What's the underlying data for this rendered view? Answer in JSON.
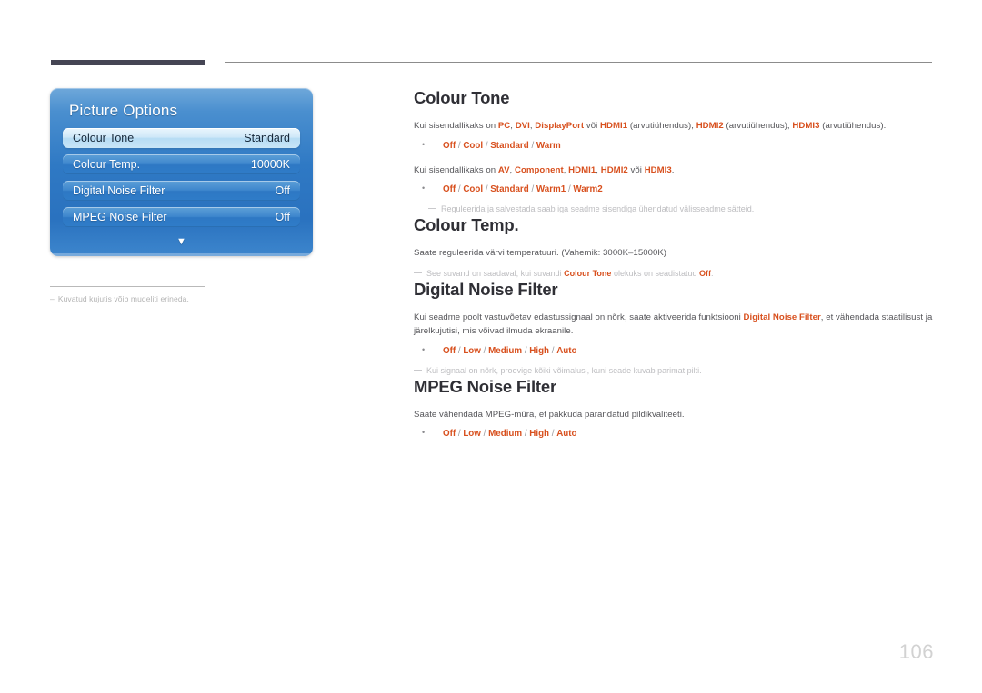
{
  "page": {
    "number": "106",
    "language": "Estonian"
  },
  "osd": {
    "title": "Picture Options",
    "scroll_indicator": "▼",
    "rows": [
      {
        "label": "Colour Tone",
        "value": "Standard",
        "selected": true
      },
      {
        "label": "Colour Temp.",
        "value": "10000K",
        "selected": false
      },
      {
        "label": "Digital Noise Filter",
        "value": "Off",
        "selected": false
      },
      {
        "label": "MPEG Noise Filter",
        "value": "Off",
        "selected": false
      }
    ],
    "caption": "Kuvatud kujutis võib mudeliti erineda.",
    "caption_dash": "–"
  },
  "sections": {
    "colour_tone": {
      "title": "Colour Tone",
      "para1": {
        "pre": "Kui sisendallikaks on ",
        "src1": "PC",
        "s1": ", ",
        "src2": "DVI",
        "s2": ", ",
        "src3": "DisplayPort",
        "s3": " või ",
        "src4": "HDMI1",
        "s4": " (arvutiühendus), ",
        "src5": "HDMI2",
        "s5": " (arvutiühendus), ",
        "src6": "HDMI3",
        "s6": " (arvutiühendus)."
      },
      "options1": [
        "Off",
        "Cool",
        "Standard",
        "Warm"
      ],
      "para2": {
        "pre": "Kui sisendallikaks on ",
        "src1": "AV",
        "s1": ", ",
        "src2": "Component",
        "s2": ", ",
        "src3": "HDMI1",
        "s3": ", ",
        "src4": "HDMI2",
        "s4": "  või ",
        "src5": "HDMI3",
        "s5": "."
      },
      "options2": [
        "Off",
        "Cool",
        "Standard",
        "Warm1",
        "Warm2"
      ],
      "note": "Reguleerida ja salvestada saab iga seadme sisendiga ühendatud välisseadme sätteid."
    },
    "colour_temp": {
      "title": "Colour Temp.",
      "para1": "Saate reguleerida värvi temperatuuri. (Vahemik: 3000K–15000K)",
      "note": {
        "pre": "See suvand on saadaval, kui suvandi ",
        "hl1": "Colour Tone",
        "mid": " olekuks on seadistatud ",
        "hl2": "Off",
        "post": "."
      }
    },
    "digital_noise_filter": {
      "title": "Digital Noise Filter",
      "para1": {
        "pre": "Kui seadme poolt vastuvõetav edastussignaal on nõrk, saate aktiveerida funktsiooni ",
        "hl": "Digital Noise Filter",
        "post": ", et vähendada staatilisust ja järelkujutisi, mis võivad ilmuda ekraanile."
      },
      "options": [
        "Off",
        "Low",
        "Medium",
        "High",
        "Auto"
      ],
      "note": "Kui signaal on nõrk, proovige kõiki võimalusi, kuni seade kuvab parimat pilti."
    },
    "mpeg_noise_filter": {
      "title": "MPEG Noise Filter",
      "para1": "Saate vähendada MPEG-müra, et pakkuda parandatud pildikvaliteeti.",
      "options": [
        "Off",
        "Low",
        "Medium",
        "High",
        "Auto"
      ]
    }
  },
  "colors": {
    "accent_orange": "#d8501e",
    "header_bar": "#454554",
    "osd_blue": "#2f79c4",
    "body_text": "#555559",
    "muted": "#bdbdc0"
  }
}
